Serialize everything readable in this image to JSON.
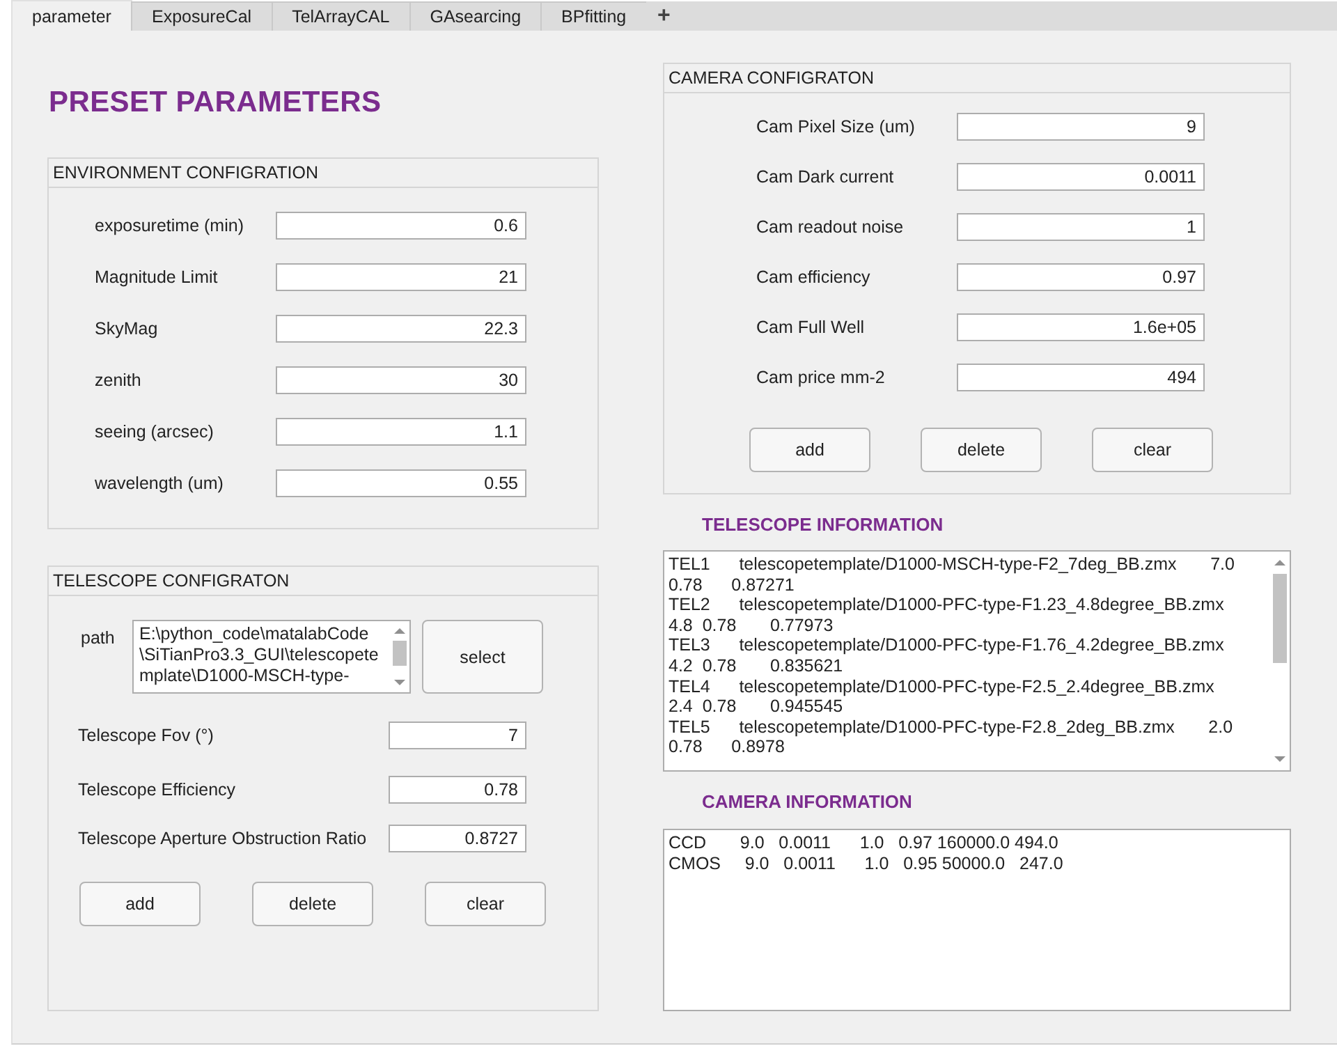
{
  "tabs": [
    {
      "label": "parameter",
      "selected": true
    },
    {
      "label": "ExposureCal",
      "selected": false
    },
    {
      "label": "TelArrayCAL",
      "selected": false
    },
    {
      "label": "GAsearcing",
      "selected": false
    },
    {
      "label": "BPfitting",
      "selected": false
    }
  ],
  "add_tab": "+",
  "title": "PRESET PARAMETERS",
  "environment": {
    "title": "ENVIRONMENT CONFIGRATION",
    "fields": [
      {
        "label": "exposuretime (min)",
        "value": "0.6"
      },
      {
        "label": "Magnitude Limit",
        "value": "21"
      },
      {
        "label": "SkyMag",
        "value": "22.3"
      },
      {
        "label": "zenith",
        "value": "30"
      },
      {
        "label": "seeing (arcsec)",
        "value": "1.1"
      },
      {
        "label": "wavelength (um)",
        "value": "0.55"
      }
    ]
  },
  "telescope": {
    "title": "TELESCOPE CONFIGRATON",
    "path_label": "path",
    "path_value": "E:\\python_code\\matalabCode\\SiTianPro3.3_GUI\\telescopetemplate\\D1000-MSCH-type-",
    "select_button": "select",
    "fields": [
      {
        "label": "Telescope Fov (°)",
        "value": "7"
      },
      {
        "label": "Telescope Efficiency",
        "value": "0.78"
      },
      {
        "label": "Telescope Aperture Obstruction Ratio",
        "value": "0.8727"
      }
    ],
    "buttons": [
      "add",
      "delete",
      "clear"
    ]
  },
  "camera": {
    "title": "CAMERA CONFIGRATON",
    "fields": [
      {
        "label": "Cam Pixel Size (um)",
        "value": "9"
      },
      {
        "label": "Cam Dark current",
        "value": "0.0011"
      },
      {
        "label": "Cam readout noise",
        "value": "1"
      },
      {
        "label": "Cam efficiency",
        "value": "0.97"
      },
      {
        "label": "Cam Full Well",
        "value": "1.6e+05"
      },
      {
        "label": "Cam price mm-2",
        "value": "494"
      }
    ],
    "buttons": [
      "add",
      "delete",
      "clear"
    ]
  },
  "telescope_information": {
    "title": "TELESCOPE INFORMATION",
    "lines": [
      "TEL1      telescopetemplate/D1000-MSCH-type-F2_7deg_BB.zmx       7.0",
      "0.78      0.87271",
      "TEL2      telescopetemplate/D1000-PFC-type-F1.23_4.8degree_BB.zmx",
      "4.8  0.78       0.77973",
      "TEL3      telescopetemplate/D1000-PFC-type-F1.76_4.2degree_BB.zmx",
      "4.2  0.78       0.835621",
      "TEL4      telescopetemplate/D1000-PFC-type-F2.5_2.4degree_BB.zmx",
      "2.4  0.78       0.945545",
      "TEL5      telescopetemplate/D1000-PFC-type-F2.8_2deg_BB.zmx       2.0",
      "0.78      0.8978"
    ]
  },
  "camera_information": {
    "title": "CAMERA INFORMATION",
    "lines": [
      "CCD       9.0   0.0011      1.0   0.97 160000.0 494.0",
      "CMOS     9.0   0.0011      1.0   0.95 50000.0   247.0"
    ]
  }
}
